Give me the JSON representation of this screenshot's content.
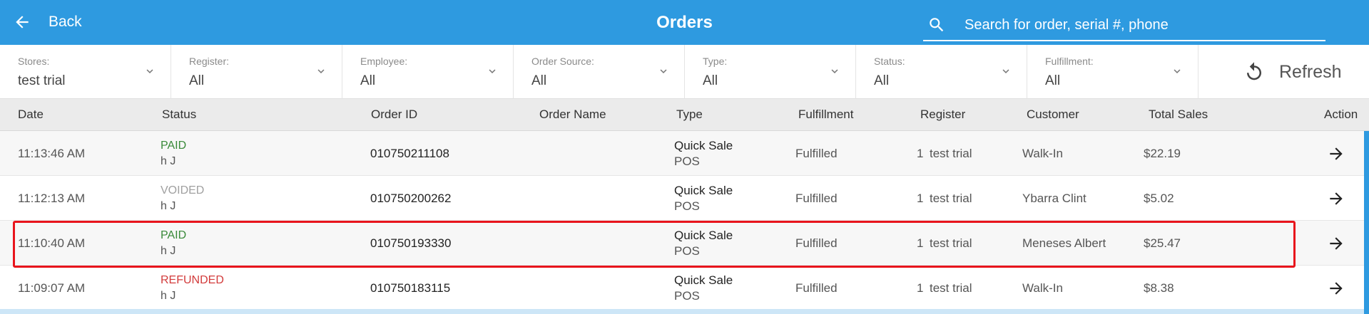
{
  "header": {
    "back_label": "Back",
    "title": "Orders",
    "search_placeholder": "Search for order, serial #, phone",
    "search_value": ""
  },
  "filters": [
    {
      "label": "Stores:",
      "value": "test trial"
    },
    {
      "label": "Register:",
      "value": "All"
    },
    {
      "label": "Employee:",
      "value": "All"
    },
    {
      "label": "Order Source:",
      "value": "All"
    },
    {
      "label": "Type:",
      "value": "All"
    },
    {
      "label": "Status:",
      "value": "All"
    },
    {
      "label": "Fulfillment:",
      "value": "All"
    }
  ],
  "refresh_label": "Refresh",
  "columns": [
    "Date",
    "Status",
    "Order ID",
    "Order Name",
    "Type",
    "Fulfillment",
    "Register",
    "Customer",
    "Total Sales",
    "Action"
  ],
  "rows": [
    {
      "date": "11:13:46 AM",
      "status": "PAID",
      "status_color": "#3a8a3a",
      "employee": "h J",
      "order_id": "010750211108",
      "order_name": "",
      "type": "Quick Sale",
      "type_sub": "POS",
      "fulfillment": "Fulfilled",
      "register_num": "1",
      "register_name": "test trial",
      "customer": "Walk-In",
      "total": "$22.19"
    },
    {
      "date": "11:12:13 AM",
      "status": "VOIDED",
      "status_color": "#a0a0a0",
      "employee": "h J",
      "order_id": "010750200262",
      "order_name": "",
      "type": "Quick Sale",
      "type_sub": "POS",
      "fulfillment": "Fulfilled",
      "register_num": "1",
      "register_name": "test trial",
      "customer": "Ybarra Clint",
      "total": "$5.02"
    },
    {
      "date": "11:10:40 AM",
      "status": "PAID",
      "status_color": "#3a8a3a",
      "employee": "h J",
      "order_id": "010750193330",
      "order_name": "",
      "type": "Quick Sale",
      "type_sub": "POS",
      "fulfillment": "Fulfilled",
      "register_num": "1",
      "register_name": "test trial",
      "customer": "Meneses Albert",
      "total": "$25.47"
    },
    {
      "date": "11:09:07 AM",
      "status": "REFUNDED",
      "status_color": "#d23b3b",
      "employee": "h J",
      "order_id": "010750183115",
      "order_name": "",
      "type": "Quick Sale",
      "type_sub": "POS",
      "fulfillment": "Fulfilled",
      "register_num": "1",
      "register_name": "test trial",
      "customer": "Walk-In",
      "total": "$8.38"
    }
  ],
  "icons": {
    "back": "arrow-left-icon",
    "search": "search-icon",
    "chevron": "chevron-down-icon",
    "refresh": "refresh-icon",
    "action": "arrow-right-icon"
  },
  "colors": {
    "header": "#2e9ae0",
    "highlight": "#e8141c",
    "paid": "#3a8a3a",
    "voided": "#a0a0a0",
    "refunded": "#d23b3b"
  }
}
